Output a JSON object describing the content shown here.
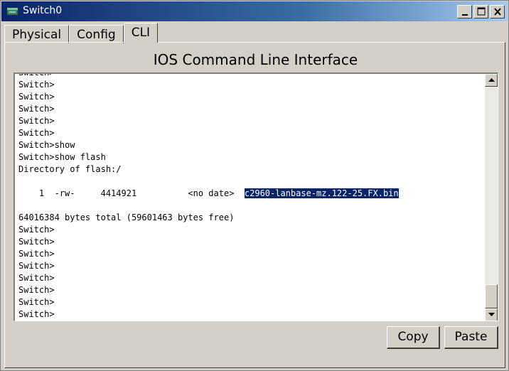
{
  "window": {
    "title": "Switch0",
    "icon": "switch-device-icon",
    "controls": [
      "minimize-icon",
      "maximize-icon",
      "close-icon"
    ]
  },
  "tabs": [
    {
      "label": "Physical",
      "active": false
    },
    {
      "label": "Config",
      "active": false
    },
    {
      "label": "CLI",
      "active": true
    }
  ],
  "cli": {
    "heading": "IOS Command Line Interface",
    "lines": [
      "Switch>",
      "Switch>",
      "Switch>",
      "Switch>",
      "Switch>",
      "Switch>",
      "Switch>show",
      "Switch>show flash",
      "Directory of flash:/",
      "",
      "    1  -rw-     4414921          <no date>  ",
      "",
      "64016384 bytes total (59601463 bytes free)",
      "Switch>",
      "Switch>",
      "Switch>",
      "Switch>",
      "Switch>",
      "Switch>",
      "Switch>",
      "Switch>"
    ],
    "selected_text": "c2960-lanbase-mz.122-25.FX.bin"
  },
  "buttons": {
    "copy": "Copy",
    "paste": "Paste"
  },
  "colors": {
    "titlebar": "#0a246a",
    "selection": "#0a246a",
    "face": "#d4d0c8"
  }
}
